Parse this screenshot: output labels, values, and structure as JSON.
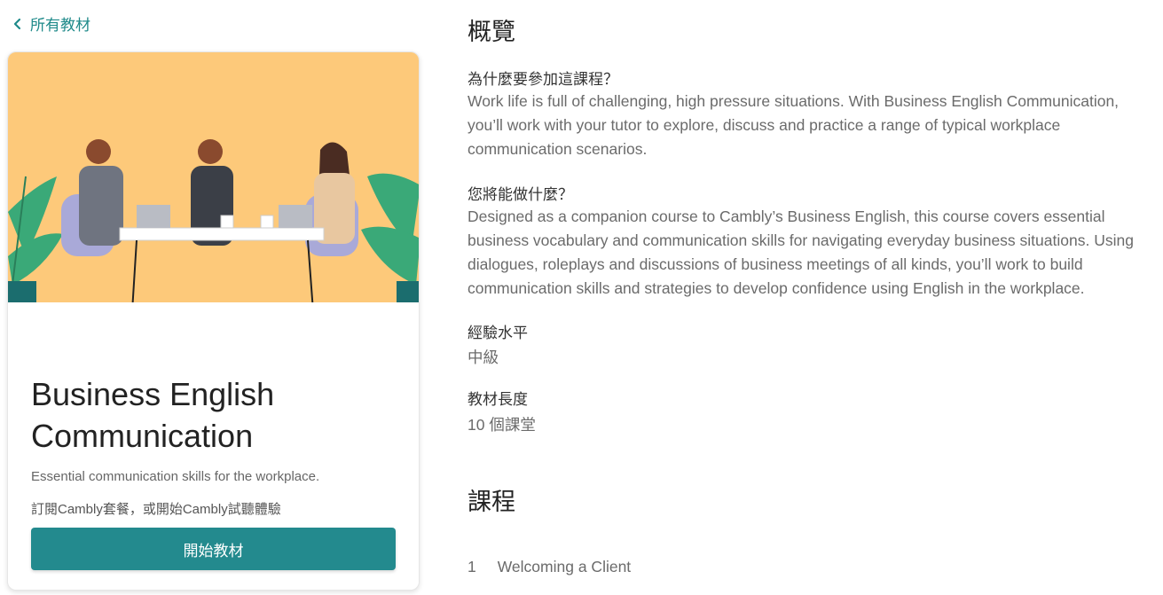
{
  "nav": {
    "back_label": "所有教材"
  },
  "course_card": {
    "title": "Business English Communication",
    "subtitle": "Essential communication skills for the workplace.",
    "note": "訂閱Cambly套餐，或開始Cambly試聽體驗",
    "start_button_label": "開始教材"
  },
  "overview": {
    "heading": "概覽",
    "why_label": "為什麼要參加這課程？",
    "why_body": "Work life is full of challenging, high pressure situations. With Business English Communication, you’ll work with your tutor to explore, discuss and practice a range of typical workplace communication scenarios.",
    "can_do_label": "您將能做什麼？",
    "can_do_body": "Designed as a companion course to Cambly’s Business English, this course covers essential business vocabulary and communication skills for navigating everyday business situations. Using dialogues, roleplays and discussions of business meetings of all kinds, you’ll work to build communication skills and strategies to develop confidence using English in the workplace.",
    "level_label": "經驗水平",
    "level_value": "中級",
    "length_label": "教材長度",
    "length_value": "10 個課堂"
  },
  "lessons": {
    "heading": "課程",
    "items": [
      {
        "number": "1",
        "title": "Welcoming a Client"
      }
    ]
  },
  "colors": {
    "accent": "#238a8e",
    "link": "#1f8a8a",
    "illustration_bg": "#fdc97a"
  }
}
